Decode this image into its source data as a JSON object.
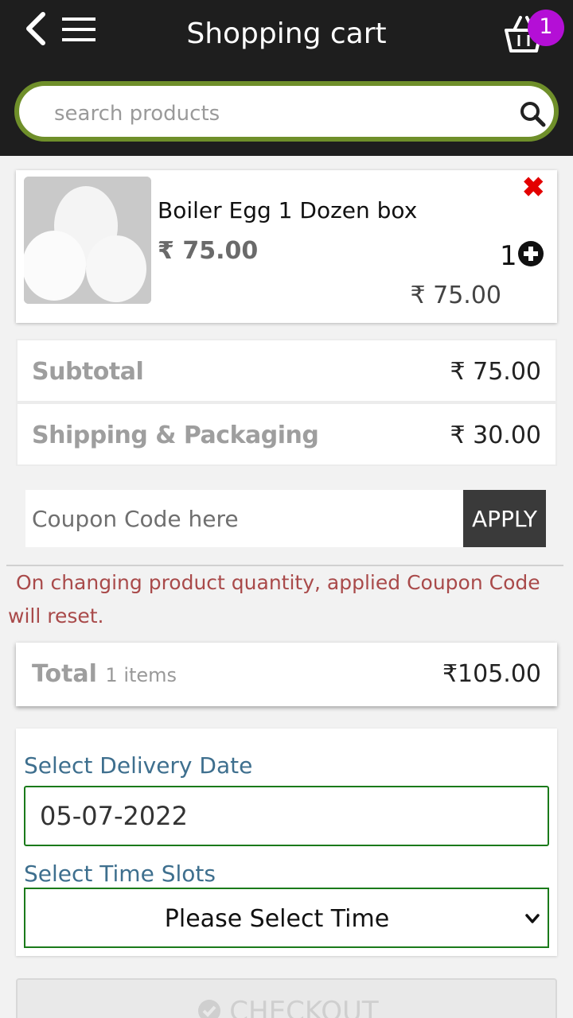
{
  "header": {
    "title": "Shopping cart",
    "cart_count": "1"
  },
  "search": {
    "placeholder": "search products"
  },
  "product": {
    "name": "Boiler Egg 1 Dozen box",
    "price": "₹ 75.00",
    "quantity": "1",
    "line_total": "₹ 75.00"
  },
  "summary": {
    "subtotal_label": "Subtotal",
    "subtotal_value": "₹ 75.00",
    "shipping_label": "Shipping & Packaging",
    "shipping_value": "₹ 30.00"
  },
  "coupon": {
    "placeholder": "Coupon Code here",
    "apply_label": "APPLY"
  },
  "notice": "On changing product quantity, applied Coupon Code will reset.",
  "total": {
    "label": "Total",
    "items": "1 items",
    "value": "₹105.00"
  },
  "delivery": {
    "date_label": "Select Delivery Date",
    "date_value": "05-07-2022",
    "time_label": "Select Time Slots",
    "time_value": "Please Select Time"
  },
  "checkout": {
    "label": "CHECKOUT"
  },
  "colors": {
    "header_bg": "#1e1e1e",
    "search_border": "#6f8f2a",
    "badge": "#b40fd6",
    "remove": "#e30000",
    "notice": "#a94a4a",
    "label_blue": "#3e6f8e",
    "field_border": "#1a7a1a"
  }
}
